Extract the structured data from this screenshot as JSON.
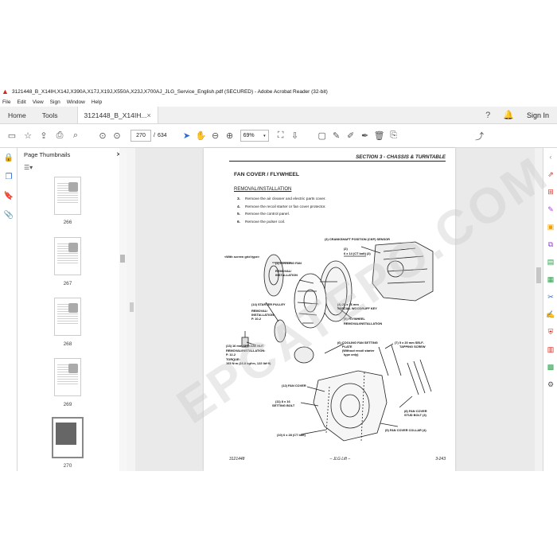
{
  "window": {
    "title": "3121448_B_X14IH,X14J,X390A,X17J,X19J,X550A,X23J,X700AJ_JLG_Service_English.pdf (SECURED) - Adobe Acrobat Reader (32-bit)"
  },
  "menu": [
    "File",
    "Edit",
    "View",
    "Sign",
    "Window",
    "Help"
  ],
  "tabs": {
    "home": "Home",
    "tools": "Tools",
    "document": "3121448_B_X14IH...",
    "close": "×",
    "sign_in": "Sign In"
  },
  "toolbar": {
    "page_current": "270",
    "page_separator": "/",
    "page_total": "634",
    "zoom": "69%"
  },
  "thumbnails": {
    "panel_title": "Page Thumbnails",
    "close": "×",
    "pages": [
      "266",
      "267",
      "268",
      "269",
      "270"
    ],
    "selected": "270"
  },
  "document": {
    "section_header": "SECTION 3 - CHASSIS & TURNTABLE",
    "title": "FAN COVER / FLYWHEEL",
    "subtitle": "REMOVAL/INSTALLATION",
    "steps": [
      {
        "num": "3.",
        "text": "Remove the air cleaner and electric parts cover."
      },
      {
        "num": "4.",
        "text": "Remove the recoil starter or fan cover protector."
      },
      {
        "num": "5.",
        "text": "Remove the control panel."
      },
      {
        "num": "6.",
        "text": "Remove the pulser coil."
      }
    ],
    "labels": {
      "ckp": "(3) CRANKSHAFT POSITION (CKP) SENSOR",
      "bolt2": "(2)",
      "bolt2b": "6 x 14 (CT bolt) (2)",
      "screen": "<With screen grid type>",
      "fan": "(1) COOLING FAN",
      "fan_ri": "REMOVAL/",
      "fan_ri2": "INSTALLATION",
      "pulley": "(14) STARTER PULLEY",
      "pulley_ri": "REMOVAL/",
      "pulley_ri2": "INSTALLATION:",
      "pulley_p": "P. 10-2",
      "woodruff": "(4) 25 x 16 mm",
      "woodruff2": "SPECIAL WOODRUFF KEY",
      "flywheel": "(5) FLYWHEEL",
      "flywheel_ri": "REMOVAL/INSTALLATION",
      "nut": "(13) 16 mm SPECIAL NUT",
      "nut_ri": "REMOVAL/INSTALLATION:",
      "nut_p": "P. 12-2",
      "torque": "TORQUE:",
      "torque_v": "165 N·m (16.8 kgf·m, 122 lbf·ft)",
      "plate": "(6) COOLING FAN SETTING",
      "plate2": "PLATE",
      "plate3": "(Without recoil starter",
      "plate4": "type only)",
      "screw": "(7) 5 x 20 mm SELF-",
      "screw2": "TAPPING SCREW",
      "fancover": "(12) FAN COVER",
      "setbolt": "(11) 8 x 16",
      "setbolt2": "SETTING BOLT",
      "stud": "(8) FAN COVER",
      "stud2": "STUD BOLT (3)",
      "collar": "(9) FAN COVER COLLAR (4)",
      "ctbolt": "(10) 6 x 28 (CT bolt)"
    },
    "footer_left": "3121448",
    "footer_center": "– JLG Lift –",
    "footer_right": "3-243",
    "watermark": "EPCATEPO.COM"
  },
  "colors": {
    "accent": "#2a6bd1",
    "pdf_red": "#d4281c"
  }
}
